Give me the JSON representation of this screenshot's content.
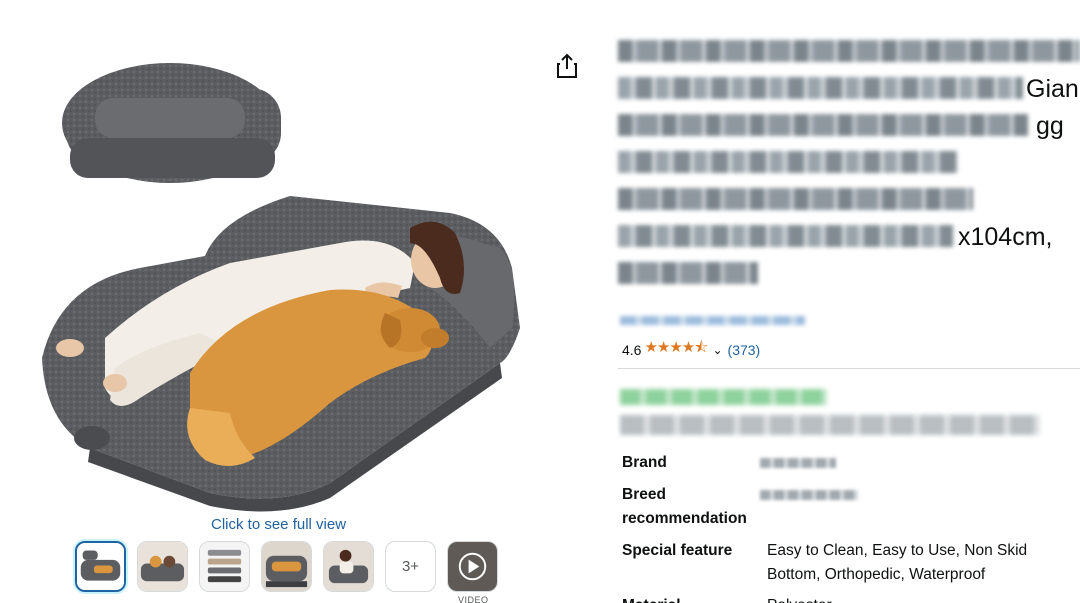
{
  "gallery": {
    "full_view_link": "Click to see full view",
    "thumbnails": [
      {
        "label": "image-1",
        "selected": true
      },
      {
        "label": "image-2",
        "selected": false
      },
      {
        "label": "image-3",
        "selected": false
      },
      {
        "label": "image-4",
        "selected": false
      },
      {
        "label": "image-5",
        "selected": false
      }
    ],
    "more_count": "3+",
    "video_label": "VIDEO"
  },
  "share": {
    "icon": "share-icon"
  },
  "product": {
    "title_fragments": {
      "line2_tail": "Gian",
      "line3_tail": "gg",
      "line6_tail": "x104cm,"
    },
    "rating": {
      "value": "4.6",
      "stars": "★★★★⯪",
      "count": "(373)"
    }
  },
  "specs": [
    {
      "label": "Brand",
      "value": ""
    },
    {
      "label": "Breed recommendation",
      "value": ""
    },
    {
      "label": "Special feature",
      "value": "Easy to Clean, Easy to Use, Non Skid Bottom, Orthopedic, Waterproof"
    },
    {
      "label": "Material",
      "value": "Polyester"
    }
  ],
  "colors": {
    "link": "#2162a1",
    "star": "#de7921",
    "bed_gray": "#5c5e62"
  }
}
